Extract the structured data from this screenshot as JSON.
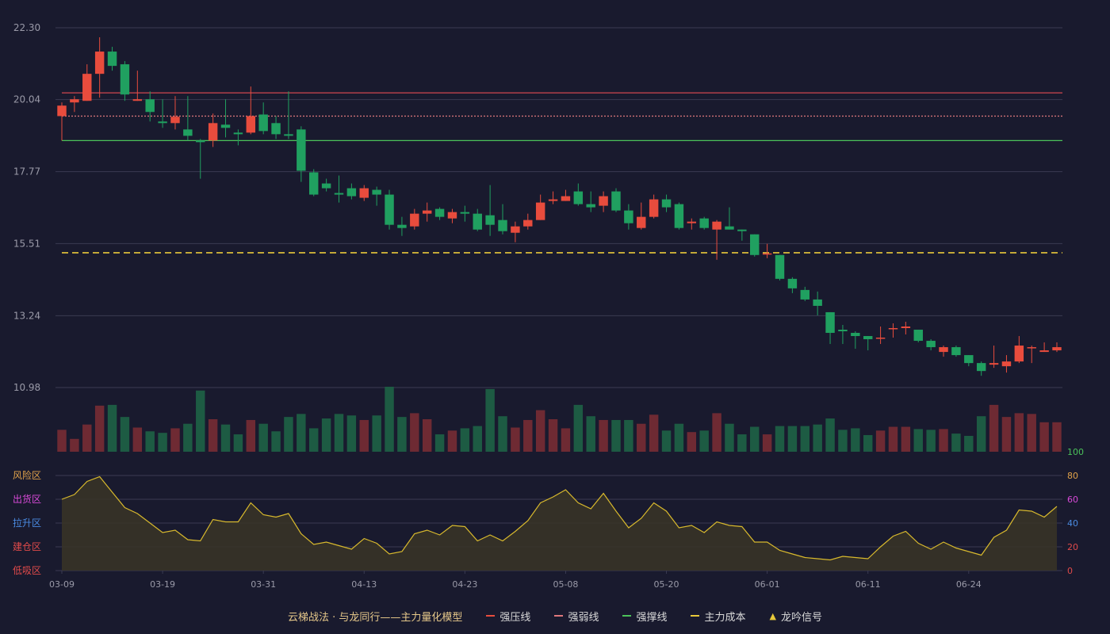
{
  "colors": {
    "up": "#e84c3d",
    "down": "#20a060",
    "vol_up": "#6e2a33",
    "vol_down": "#1d5b43",
    "resistance": "#c0434c",
    "weak": "#e0787c",
    "support": "#4bc25a",
    "cost": "#e7c83a",
    "osc_line": "#d8b92d",
    "grid": "#3a3b52",
    "axis_text": "#9a9aa8"
  },
  "legend": {
    "title": "云梯战法 · 与龙同行——主力量化模型",
    "items": [
      {
        "label": "强压线",
        "color": "#e84c3d",
        "dash": false,
        "icon": "line-solid-icon"
      },
      {
        "label": "强弱线",
        "color": "#e0787c",
        "dash": true,
        "icon": "line-dotted-icon"
      },
      {
        "label": "强撑线",
        "color": "#4bc25a",
        "dash": false,
        "icon": "line-solid-icon"
      },
      {
        "label": "主力成本",
        "color": "#e7c83a",
        "dash": true,
        "icon": "line-dashed-icon"
      },
      {
        "label": "龙吟信号",
        "color": "#e7c83a",
        "dash": false,
        "icon": "triangle-up-icon"
      }
    ]
  },
  "chart_data": {
    "type": "candlestick",
    "dates_labels": [
      "03-09",
      "03-19",
      "03-31",
      "04-13",
      "04-23",
      "05-08",
      "05-20",
      "06-01",
      "06-11",
      "06-24"
    ],
    "dates_label_index": [
      0,
      8,
      16,
      24,
      32,
      40,
      48,
      56,
      64,
      72
    ],
    "price_axis": {
      "ticks": [
        "22.30",
        "20.04",
        "17.77",
        "15.51",
        "13.24",
        "10.98"
      ],
      "ylim": [
        10.98,
        22.3
      ]
    },
    "lines": {
      "resistance": 20.25,
      "weak": 19.52,
      "support": 18.75,
      "cost": 15.22
    },
    "candles": [
      [
        19.52,
        19.85,
        19.95,
        18.75
      ],
      [
        19.95,
        20.05,
        20.15,
        19.65
      ],
      [
        20.0,
        20.85,
        21.15,
        20.0
      ],
      [
        20.85,
        21.55,
        22.0,
        20.1
      ],
      [
        21.55,
        21.1,
        21.7,
        20.95
      ],
      [
        21.15,
        20.2,
        21.25,
        20.0
      ],
      [
        20.0,
        20.05,
        20.95,
        20.0
      ],
      [
        20.05,
        19.65,
        20.3,
        19.35
      ],
      [
        19.35,
        19.3,
        20.05,
        19.15
      ],
      [
        19.3,
        19.5,
        20.15,
        19.1
      ],
      [
        19.1,
        18.9,
        20.15,
        18.75
      ],
      [
        18.75,
        18.7,
        18.8,
        17.55
      ],
      [
        18.75,
        19.3,
        19.6,
        18.55
      ],
      [
        19.25,
        19.15,
        20.05,
        18.85
      ],
      [
        19.0,
        18.95,
        19.1,
        18.6
      ],
      [
        19.0,
        19.52,
        20.45,
        18.95
      ],
      [
        19.57,
        19.05,
        19.95,
        18.95
      ],
      [
        19.3,
        18.95,
        19.52,
        18.8
      ],
      [
        18.95,
        18.9,
        20.3,
        18.8
      ],
      [
        19.1,
        17.8,
        19.2,
        17.45
      ],
      [
        17.75,
        17.05,
        17.85,
        17.0
      ],
      [
        17.4,
        17.25,
        17.55,
        17.15
      ],
      [
        17.1,
        17.05,
        17.65,
        16.8
      ],
      [
        17.25,
        17.0,
        17.4,
        16.9
      ],
      [
        16.95,
        17.25,
        17.35,
        16.85
      ],
      [
        17.2,
        17.05,
        17.3,
        16.7
      ],
      [
        17.05,
        16.1,
        17.2,
        15.95
      ],
      [
        16.1,
        16.0,
        16.35,
        15.75
      ],
      [
        16.05,
        16.45,
        16.6,
        15.95
      ],
      [
        16.45,
        16.55,
        16.8,
        16.2
      ],
      [
        16.6,
        16.35,
        16.65,
        16.25
      ],
      [
        16.3,
        16.5,
        16.6,
        16.15
      ],
      [
        16.5,
        16.45,
        16.7,
        16.2
      ],
      [
        16.45,
        15.95,
        16.6,
        15.9
      ],
      [
        16.4,
        16.1,
        17.35,
        15.75
      ],
      [
        16.25,
        15.9,
        16.75,
        15.8
      ],
      [
        15.85,
        16.05,
        16.2,
        15.55
      ],
      [
        16.05,
        16.25,
        16.45,
        15.95
      ],
      [
        16.25,
        16.8,
        17.05,
        16.25
      ],
      [
        16.85,
        16.9,
        17.15,
        16.75
      ],
      [
        16.85,
        17.0,
        17.2,
        16.85
      ],
      [
        17.15,
        16.75,
        17.4,
        16.7
      ],
      [
        16.75,
        16.65,
        17.15,
        16.5
      ],
      [
        16.7,
        17.0,
        17.15,
        16.5
      ],
      [
        17.15,
        16.55,
        17.25,
        16.5
      ],
      [
        16.55,
        16.15,
        16.75,
        15.95
      ],
      [
        16.0,
        16.35,
        16.8,
        15.95
      ],
      [
        16.35,
        16.9,
        17.05,
        16.3
      ],
      [
        16.9,
        16.65,
        17.05,
        16.5
      ],
      [
        16.75,
        16.0,
        16.8,
        15.95
      ],
      [
        16.15,
        16.2,
        16.3,
        15.95
      ],
      [
        16.3,
        16.0,
        16.35,
        15.95
      ],
      [
        15.95,
        16.2,
        16.25,
        15.0
      ],
      [
        16.05,
        15.95,
        16.65,
        15.95
      ],
      [
        15.95,
        15.9,
        15.95,
        15.6
      ],
      [
        15.8,
        15.15,
        15.8,
        15.1
      ],
      [
        15.2,
        15.2,
        15.5,
        15.05
      ],
      [
        15.15,
        14.4,
        15.15,
        14.35
      ],
      [
        14.4,
        14.1,
        14.45,
        13.95
      ],
      [
        14.05,
        13.75,
        14.15,
        13.7
      ],
      [
        13.75,
        13.55,
        14.0,
        13.25
      ],
      [
        13.35,
        12.7,
        13.35,
        12.35
      ],
      [
        12.8,
        12.75,
        12.95,
        12.35
      ],
      [
        12.7,
        12.6,
        12.75,
        12.2
      ],
      [
        12.6,
        12.5,
        12.6,
        12.15
      ],
      [
        12.55,
        12.55,
        12.9,
        12.35
      ],
      [
        12.85,
        12.85,
        13.0,
        12.55
      ],
      [
        12.85,
        12.9,
        13.05,
        12.65
      ],
      [
        12.8,
        12.45,
        12.8,
        12.4
      ],
      [
        12.45,
        12.25,
        12.5,
        12.15
      ],
      [
        12.1,
        12.25,
        12.3,
        11.95
      ],
      [
        12.25,
        12.0,
        12.3,
        11.95
      ],
      [
        12.0,
        11.75,
        12.0,
        11.65
      ],
      [
        11.75,
        11.5,
        11.8,
        11.35
      ],
      [
        11.7,
        11.75,
        12.3,
        11.6
      ],
      [
        11.65,
        11.8,
        12.0,
        11.45
      ],
      [
        11.8,
        12.3,
        12.6,
        11.75
      ],
      [
        12.25,
        12.25,
        12.3,
        11.75
      ],
      [
        12.1,
        12.15,
        12.4,
        12.1
      ],
      [
        12.15,
        12.25,
        12.4,
        12.1
      ]
    ],
    "volume": [
      29,
      17,
      36,
      61,
      62,
      46,
      32,
      27,
      25,
      31,
      37,
      81,
      43,
      36,
      23,
      42,
      37,
      27,
      46,
      50,
      31,
      44,
      50,
      48,
      42,
      48,
      86,
      46,
      51,
      43,
      23,
      28,
      31,
      34,
      83,
      47,
      32,
      42,
      55,
      43,
      31,
      62,
      47,
      42,
      42,
      42,
      37,
      49,
      28,
      37,
      26,
      28,
      51,
      37,
      23,
      33,
      23,
      34,
      34,
      34,
      36,
      44,
      29,
      31,
      22,
      28,
      33,
      33,
      30,
      29,
      30,
      24,
      21,
      47,
      62,
      46,
      51,
      50,
      39,
      39
    ],
    "oscillator": {
      "zones": [
        "风险区",
        "出货区",
        "拉升区",
        "建仓区",
        "低吸区"
      ],
      "zone_colors": [
        "#e0a24a",
        "#d94ad9",
        "#4a8ae0",
        "#e04a4a",
        "#e04a4a"
      ],
      "ticks": [
        "100",
        "80",
        "60",
        "40",
        "20",
        "0"
      ],
      "tick_colors": [
        "#4bc25a",
        "#e0a24a",
        "#d94ad9",
        "#4a8ae0",
        "#e04a4a",
        "#e04a4a"
      ],
      "values": [
        60,
        64,
        75,
        79,
        66,
        53,
        48,
        40,
        32,
        34,
        26,
        25,
        43,
        41,
        41,
        57,
        47,
        45,
        48,
        31,
        22,
        24,
        21,
        18,
        27,
        23,
        14,
        16,
        31,
        34,
        30,
        38,
        37,
        25,
        30,
        25,
        33,
        42,
        57,
        62,
        68,
        57,
        52,
        65,
        50,
        36,
        44,
        57,
        50,
        36,
        38,
        32,
        41,
        38,
        37,
        24,
        24,
        17,
        14,
        11,
        10,
        9,
        12,
        11,
        10,
        20,
        29,
        33,
        23,
        18,
        24,
        19,
        16,
        13,
        28,
        34,
        51,
        50,
        45,
        54
      ]
    }
  }
}
